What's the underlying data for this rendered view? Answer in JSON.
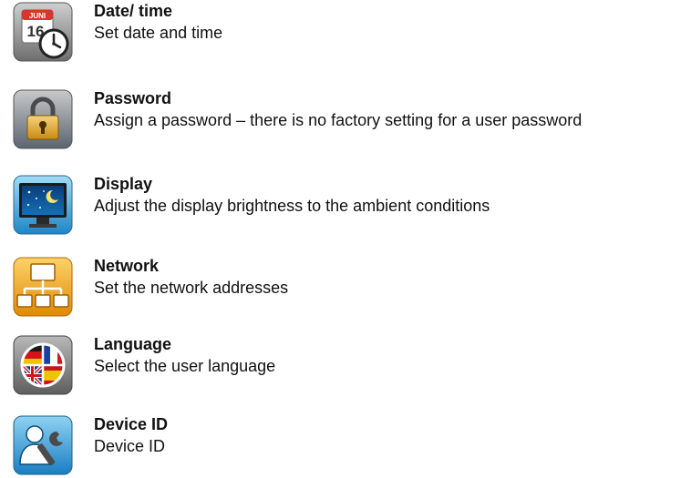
{
  "items": [
    {
      "title": "Date/ time",
      "description": "Set date and time",
      "icon": "calendar-clock-icon",
      "calendar_month": "JUNI",
      "calendar_day": "16"
    },
    {
      "title": "Password",
      "description": "Assign a password – there is no factory setting for a user password",
      "icon": "padlock-icon"
    },
    {
      "title": "Display",
      "description": "Adjust the display brightness to the ambient conditions",
      "icon": "monitor-night-icon"
    },
    {
      "title": "Network",
      "description": "Set the network addresses",
      "icon": "network-tree-icon"
    },
    {
      "title": "Language",
      "description": "Select the user language",
      "icon": "language-flags-icon"
    },
    {
      "title": "Device ID",
      "description": "Device ID",
      "icon": "device-id-icon"
    }
  ]
}
